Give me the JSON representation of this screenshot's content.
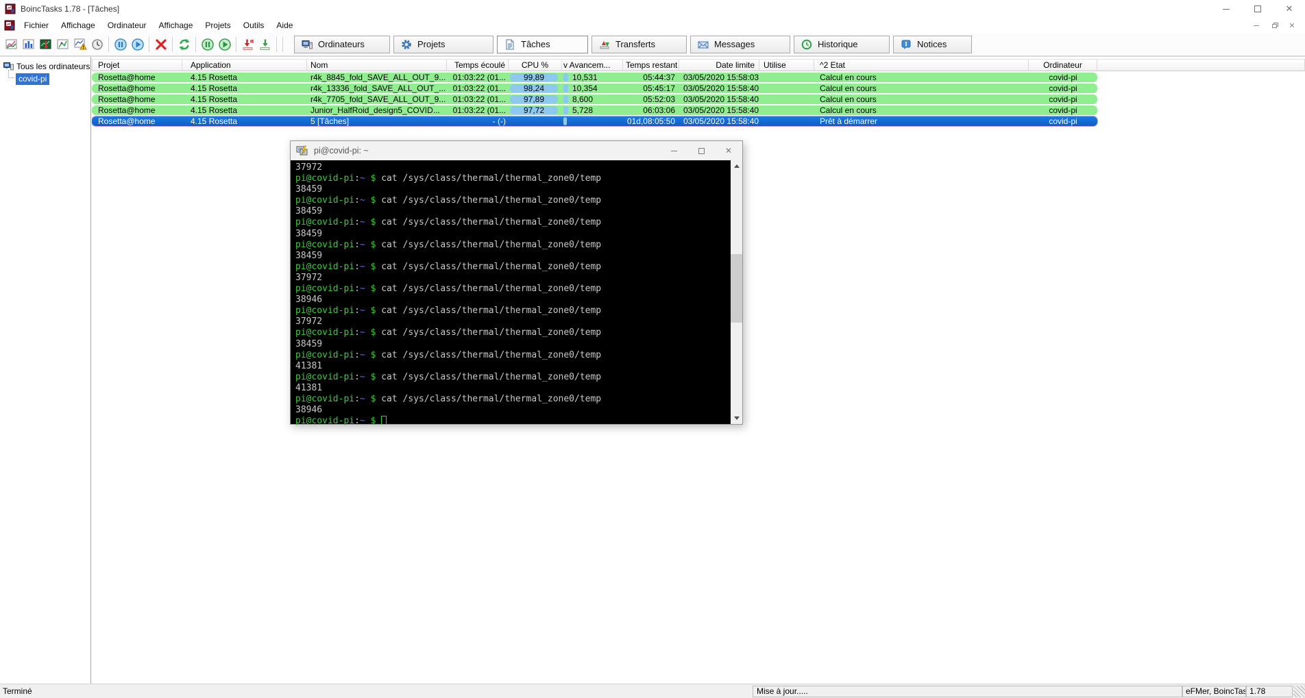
{
  "window": {
    "title": "BoincTasks 1.78 - [Tâches]"
  },
  "menu": {
    "items": [
      "Fichier",
      "Affichage",
      "Ordinateur",
      "Affichage",
      "Projets",
      "Outils",
      "Aide"
    ]
  },
  "toolbar": {
    "icons": [
      "chart-edit-icon",
      "bar-chart-icon",
      "temperature-icon",
      "chart-tree-icon",
      "chart-warning-icon",
      "clock-icon",
      "pause-blue-icon",
      "play-blue-icon",
      "abort-icon",
      "refresh-icon",
      "pause-green-icon",
      "play-green-icon",
      "transfer-suspend-icon",
      "transfer-resume-icon"
    ]
  },
  "tabs": [
    {
      "label": "Ordinateurs"
    },
    {
      "label": "Projets"
    },
    {
      "label": "Tâches",
      "active": true
    },
    {
      "label": "Transferts"
    },
    {
      "label": "Messages"
    },
    {
      "label": "Historique"
    },
    {
      "label": "Notices"
    }
  ],
  "sidebar": {
    "root_label": "Tous les ordinateurs",
    "computer": "covid-pi"
  },
  "table": {
    "columns": [
      "Projet",
      "Application",
      "Nom",
      "Temps écoulé",
      "CPU %",
      "v Avancem...",
      "Temps restant",
      "Date limite",
      "Utilise",
      "^2 Etat",
      "Ordinateur"
    ],
    "rows": [
      {
        "projet": "Rosetta@home",
        "application": "4.15 Rosetta",
        "nom": "r4k_8845_fold_SAVE_ALL_OUT_9...",
        "temps_ecoule": "01:03:22 (01...",
        "cpu": "99,89",
        "avancement": "10,531",
        "temps_restant": "05:44:37",
        "date_limite": "03/05/2020 15:58:03",
        "utilise": "",
        "etat": "Calcul en cours",
        "ordinateur": "covid-pi",
        "selected": false
      },
      {
        "projet": "Rosetta@home",
        "application": "4.15 Rosetta",
        "nom": "r4k_13336_fold_SAVE_ALL_OUT_...",
        "temps_ecoule": "01:03:22 (01...",
        "cpu": "98,24",
        "avancement": "10,354",
        "temps_restant": "05:45:17",
        "date_limite": "03/05/2020 15:58:40",
        "utilise": "",
        "etat": "Calcul en cours",
        "ordinateur": "covid-pi",
        "selected": false
      },
      {
        "projet": "Rosetta@home",
        "application": "4.15 Rosetta",
        "nom": "r4k_7705_fold_SAVE_ALL_OUT_9...",
        "temps_ecoule": "01:03:22 (01...",
        "cpu": "97,89",
        "avancement": "8,600",
        "temps_restant": "05:52:03",
        "date_limite": "03/05/2020 15:58:40",
        "utilise": "",
        "etat": "Calcul en cours",
        "ordinateur": "covid-pi",
        "selected": false
      },
      {
        "projet": "Rosetta@home",
        "application": "4.15 Rosetta",
        "nom": "Junior_HalfRoid_design5_COVID...",
        "temps_ecoule": "01:03:22 (01...",
        "cpu": "97,72",
        "avancement": "5,728",
        "temps_restant": "06:03:06",
        "date_limite": "03/05/2020 15:58:40",
        "utilise": "",
        "etat": "Calcul en cours",
        "ordinateur": "covid-pi",
        "selected": false
      },
      {
        "projet": "Rosetta@home",
        "application": "4.15 Rosetta",
        "nom": "5 [Tâches]",
        "temps_ecoule": "- (-)",
        "cpu": "",
        "avancement": "",
        "temps_restant": "01d,08:05:50",
        "date_limite": "03/05/2020 15:58:40",
        "utilise": "",
        "etat": "Prêt à démarrer",
        "ordinateur": "covid-pi",
        "selected": true
      }
    ]
  },
  "terminal": {
    "title": "pi@covid-pi: ~",
    "prompt_user": "pi@covid-pi",
    "prompt_colon": ":",
    "prompt_path": "~",
    "prompt_symbol": "$",
    "command": "cat /sys/class/thermal/thermal_zone0/temp",
    "lines": [
      {
        "kind": "output",
        "text": "37972"
      },
      {
        "kind": "command"
      },
      {
        "kind": "output",
        "text": "38459"
      },
      {
        "kind": "command"
      },
      {
        "kind": "output",
        "text": "38459"
      },
      {
        "kind": "command"
      },
      {
        "kind": "output",
        "text": "38459"
      },
      {
        "kind": "command"
      },
      {
        "kind": "output",
        "text": "38459"
      },
      {
        "kind": "command"
      },
      {
        "kind": "output",
        "text": "37972"
      },
      {
        "kind": "command"
      },
      {
        "kind": "output",
        "text": "38946"
      },
      {
        "kind": "command"
      },
      {
        "kind": "output",
        "text": "37972"
      },
      {
        "kind": "command"
      },
      {
        "kind": "output",
        "text": "38459"
      },
      {
        "kind": "command"
      },
      {
        "kind": "output",
        "text": "41381"
      },
      {
        "kind": "command"
      },
      {
        "kind": "output",
        "text": "41381"
      },
      {
        "kind": "command"
      },
      {
        "kind": "output",
        "text": "38946"
      },
      {
        "kind": "cursor"
      }
    ]
  },
  "statusbar": {
    "status": "Terminé",
    "update": "Mise à jour.....",
    "brand": "eFMer, BoincTasks",
    "version": "1.78"
  },
  "colors": {
    "row_green": "#90ee90",
    "row_selected_blue": "#0c5ec6",
    "selected_outline_pink": "#d9a0d9",
    "progress_pill_blue": "#8dc9ef",
    "terminal_green": "#3ccd3c",
    "terminal_blue": "#6161ff",
    "terminal_text": "#c8c8c8"
  }
}
